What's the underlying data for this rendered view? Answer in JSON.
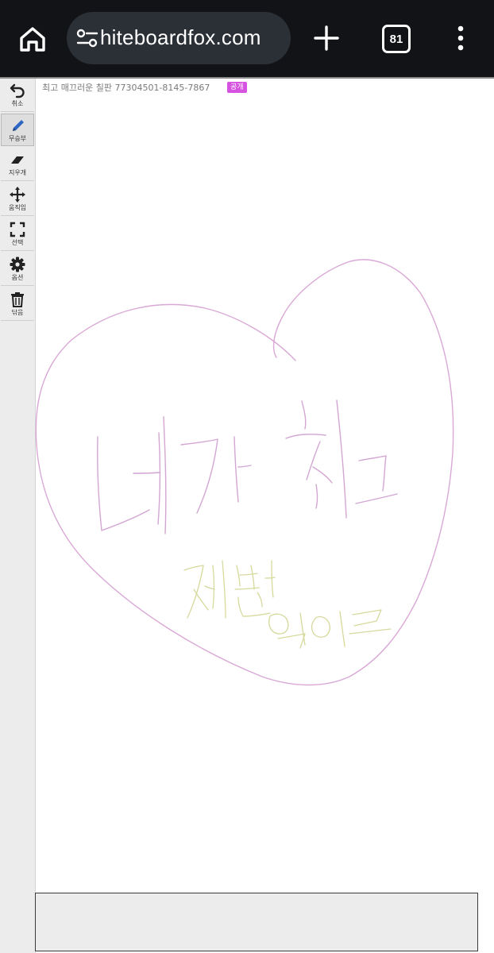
{
  "browser": {
    "url": "hiteboardfox.com",
    "tab_count": "81",
    "icons": {
      "home": "home-icon",
      "site_settings": "tune-icon",
      "new_tab": "plus-icon",
      "tabs": "tab-switcher-icon",
      "menu": "more-vert-icon"
    }
  },
  "board": {
    "title": "최고 매끄러운 칠판 77304501-8145-7867",
    "visibility_badge": "공개",
    "badge_color": "#d652e0"
  },
  "toolbar": {
    "items": [
      {
        "label": "취소",
        "icon": "undo-icon"
      },
      {
        "label": "무승부",
        "icon": "pencil-icon",
        "active": true
      },
      {
        "label": "지우개",
        "icon": "eraser-icon"
      },
      {
        "label": "움직임",
        "icon": "move-icon"
      },
      {
        "label": "선택",
        "icon": "select-icon"
      },
      {
        "label": "옵션",
        "icon": "gear-icon"
      },
      {
        "label": "닦음",
        "icon": "trash-icon"
      }
    ]
  },
  "drawing": {
    "stroke_colors": {
      "heart": "#d9a8d6",
      "main_text": "#d3a6d3",
      "sub_text": "#d6d99c"
    }
  }
}
